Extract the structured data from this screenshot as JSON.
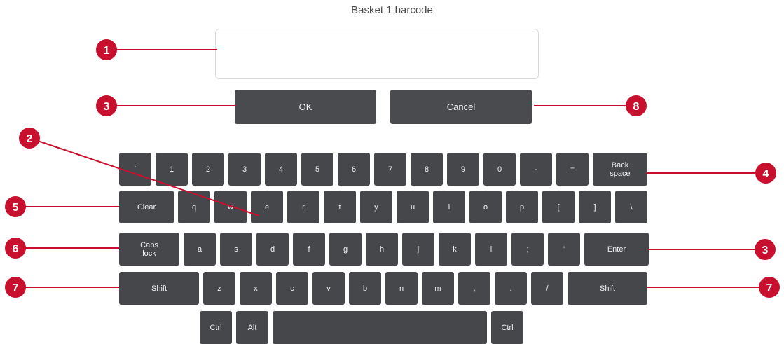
{
  "dialog": {
    "title": "Basket 1 barcode",
    "input_value": "",
    "ok_label": "OK",
    "cancel_label": "Cancel"
  },
  "keyboard": {
    "rows": [
      [
        "`",
        "1",
        "2",
        "3",
        "4",
        "5",
        "6",
        "7",
        "8",
        "9",
        "0",
        "-",
        "=",
        "Back\nspace"
      ],
      [
        "Clear",
        "q",
        "w",
        "e",
        "r",
        "t",
        "y",
        "u",
        "i",
        "o",
        "p",
        "[",
        "]",
        "\\"
      ],
      [
        "Caps\nlock",
        "a",
        "s",
        "d",
        "f",
        "g",
        "h",
        "j",
        "k",
        "l",
        ";",
        "'",
        "Enter"
      ],
      [
        "Shift",
        "z",
        "x",
        "c",
        "v",
        "b",
        "n",
        "m",
        ",",
        ".",
        "/",
        "Shift"
      ],
      [
        "Ctrl",
        "Alt",
        "",
        "Ctrl"
      ]
    ]
  },
  "callouts": {
    "badge_color": "#c8102e",
    "labels": [
      "1",
      "2",
      "3",
      "3",
      "4",
      "5",
      "6",
      "7",
      "7",
      "8"
    ]
  }
}
